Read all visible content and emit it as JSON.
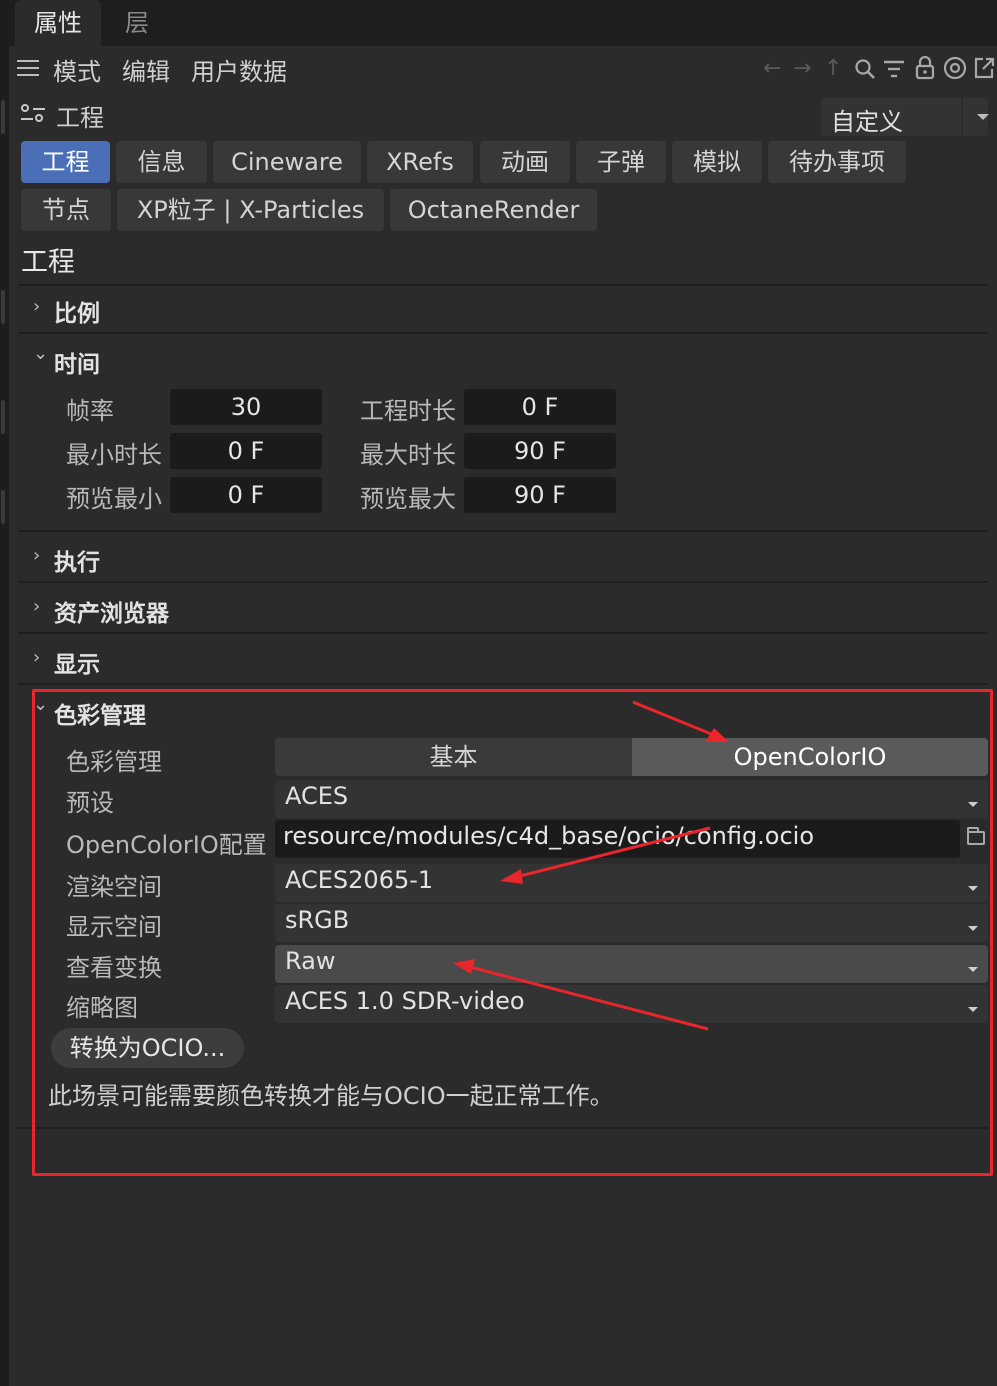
{
  "top_tabs": {
    "active": "属性",
    "inactive": "层"
  },
  "menubar": {
    "items": [
      "模式",
      "编辑",
      "用户数据"
    ]
  },
  "object": {
    "title": "工程",
    "preset": "自定义"
  },
  "section_tabs_row1": [
    "工程",
    "信息",
    "Cineware",
    "XRefs",
    "动画",
    "子弹",
    "模拟",
    "待办事项"
  ],
  "section_tabs_row2": [
    "节点",
    "XP粒子 | X-Particles",
    "OctaneRender"
  ],
  "heading": "工程",
  "groups": {
    "scale": "比例",
    "time": "时间",
    "execute": "执行",
    "asset_browser": "资产浏览器",
    "display": "显示",
    "color_mgmt": "色彩管理"
  },
  "time_fields": {
    "fps_label": "帧率",
    "fps_value": "30",
    "proj_len_label": "工程时长",
    "proj_len_value": "0 F",
    "min_label": "最小时长",
    "min_value": "0 F",
    "max_label": "最大时长",
    "max_value": "90 F",
    "prev_min_label": "预览最小",
    "prev_min_value": "0 F",
    "prev_max_label": "预览最大",
    "prev_max_value": "90 F"
  },
  "color_management": {
    "mode_label": "色彩管理",
    "mode_options": [
      "基本",
      "OpenColorIO"
    ],
    "mode_selected": "OpenColorIO",
    "preset_label": "预设",
    "preset_value": "ACES",
    "config_label": "OpenColorIO配置",
    "config_value": "resource/modules/c4d_base/ocio/config.ocio",
    "render_space_label": "渲染空间",
    "render_space_value": "ACES2065-1",
    "display_space_label": "显示空间",
    "display_space_value": "sRGB",
    "view_transform_label": "查看变换",
    "view_transform_value": "Raw",
    "thumbnail_label": "缩略图",
    "thumbnail_value": "ACES 1.0 SDR-video",
    "convert_button": "转换为OCIO...",
    "note": "此场景可能需要颜色转换才能与OCIO一起正常工作。"
  },
  "colors": {
    "panel_bg": "#2b2b2b",
    "active_tab": "#4a6fb6",
    "annotation_red": "#e8262b",
    "field_bg": "#1b1b1b"
  },
  "icons": [
    "hamburger-icon",
    "back-arrow-icon",
    "forward-arrow-icon",
    "up-arrow-icon",
    "search-icon",
    "filter-icon",
    "lock-icon",
    "target-icon",
    "new-window-icon",
    "project-icon",
    "folder-icon",
    "chevron-right-icon",
    "chevron-down-icon",
    "dropdown-arrow-icon"
  ]
}
